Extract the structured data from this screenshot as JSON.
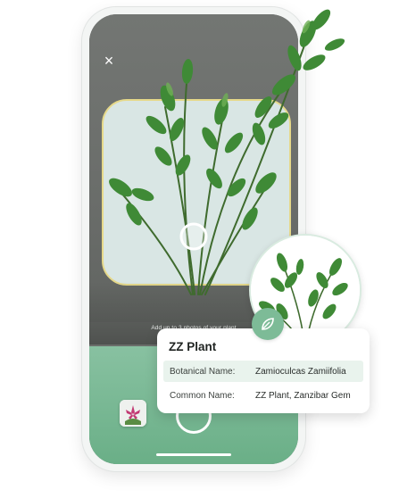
{
  "camera": {
    "close_glyph": "×",
    "hint_text": "Add up to 3 photos of your plant",
    "close_icon": "close-icon",
    "shutter_icon": "shutter-button"
  },
  "result_card": {
    "title": "ZZ Plant",
    "rows": [
      {
        "label": "Botanical Name:",
        "value": "Zamioculcas Zamiifolia"
      },
      {
        "label": "Common Name:",
        "value": "ZZ Plant, Zanzibar Gem"
      }
    ],
    "badge_icon": "leaf-icon"
  },
  "colors": {
    "accent_green": "#6aaf87",
    "panel_green": "#88c1a1",
    "frame_yellow": "#e6d98a",
    "leaf_green": "#3f8a36"
  }
}
